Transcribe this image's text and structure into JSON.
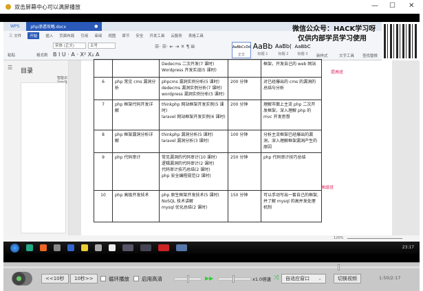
{
  "window": {
    "title": "双击屏幕中心可以满屏播放",
    "min": "—",
    "max": "☐",
    "close": "✕"
  },
  "wps": {
    "brand": "WPS",
    "doc_tab": "php渗透攻略.docx",
    "menu": [
      "三 文件",
      "开始",
      "插入",
      "页面布局",
      "引用",
      "审阅",
      "视图",
      "章节",
      "安全",
      "开发工具",
      "云服务",
      "表格工具"
    ],
    "ribbon": {
      "paste": "粘贴",
      "format_painter": "格式刷",
      "font": "宋体 (正文)",
      "size": "五号",
      "styles": [
        {
          "sample": "AaBbCcDd",
          "name": "正文"
        },
        {
          "sample": "AaBb",
          "name": "标题 1"
        },
        {
          "sample": "AaBb(",
          "name": "标题 2"
        },
        {
          "sample": "AaBbC",
          "name": "标题 3"
        }
      ],
      "new_style": "新样式",
      "text_tools": "文字工具",
      "find_replace": "查找替换"
    },
    "watermark": [
      "微信公众号：HACK学习呀",
      "仅供内部学员学习使用"
    ],
    "sidebar": {
      "title": "目录",
      "smart": "智能识别目录"
    },
    "table": {
      "rows": [
        {
          "no": "",
          "topic": "",
          "content": [
            "Dedecms 二次开发(7 课时)",
            "Wordpress 开发实战(5 课时)"
          ],
          "time": "",
          "goal": "框架，开发自己的 web 网站"
        },
        {
          "no": "6",
          "topic": "php 常见 cms 漏洞分析",
          "content": [
            "phpcms 漏洞实例分析(5 课时)",
            "dedecms 漏洞实例分析(7 课时)",
            "wordpress 漏洞实例分析(5 课时)"
          ],
          "time": "200 分钟",
          "goal": "对已经爆出的 cms 的漏洞的总结与分析"
        },
        {
          "no": "7",
          "topic": "php 框架代码开发详解",
          "content": [
            "thinkphp 网站框架开发实例(5 课时)",
            "laravel 网站框架开发实例(6 课时)"
          ],
          "time": "200 分钟",
          "goal": "理解市面上主流 php 二次开发框架，深入理解 php 的 mvc 开发思想"
        },
        {
          "no": "8",
          "topic": "php 框架漏洞分析详解",
          "content": [
            "thinkphp 漏洞分析(5 课时)",
            "laravel 漏洞分析(3 课时)"
          ],
          "time": "100 分钟",
          "goal": "分析主流框架已经爆出的漏洞，深入理解框架漏洞产生的原因"
        },
        {
          "no": "9",
          "topic": "php 代码审计",
          "content": [
            "常见漏洞的代码审计(10 课时)",
            "逻辑漏洞的代码审计(2 课时)",
            "代码审计技巧总结(2 课时)",
            "php 安全编程规范(2 课时)"
          ],
          "time": "250 分钟",
          "goal": "php 代码审计技巧总结"
        },
        {
          "no": "10",
          "topic": "php 高级开发技术",
          "content": [
            "php 原生框架开发技术(5 课时)",
            "NoSQL 技术讲解",
            "mysql 优化总结(2 课时)"
          ],
          "time": "150 分钟",
          "goal": "可以手动写出一套自己的框架,并了解 mysql 的高并发处理机制"
        }
      ],
      "level_1": "提高班",
      "level_2": "高级班"
    },
    "zoom": "120%"
  },
  "taskbar": {
    "time": "23:17"
  },
  "player": {
    "back10": "<<10秒",
    "fwd10": "10秒>>",
    "loop": "循环播放",
    "hd": "启用高清",
    "speed": "x1.0倍速",
    "fit": "自适应窗口",
    "switch": "切换视频",
    "time": "1:50/2:17",
    "progress": 0.803
  },
  "colors": {
    "accent": "#2a59b8",
    "level": "#e0245e"
  }
}
